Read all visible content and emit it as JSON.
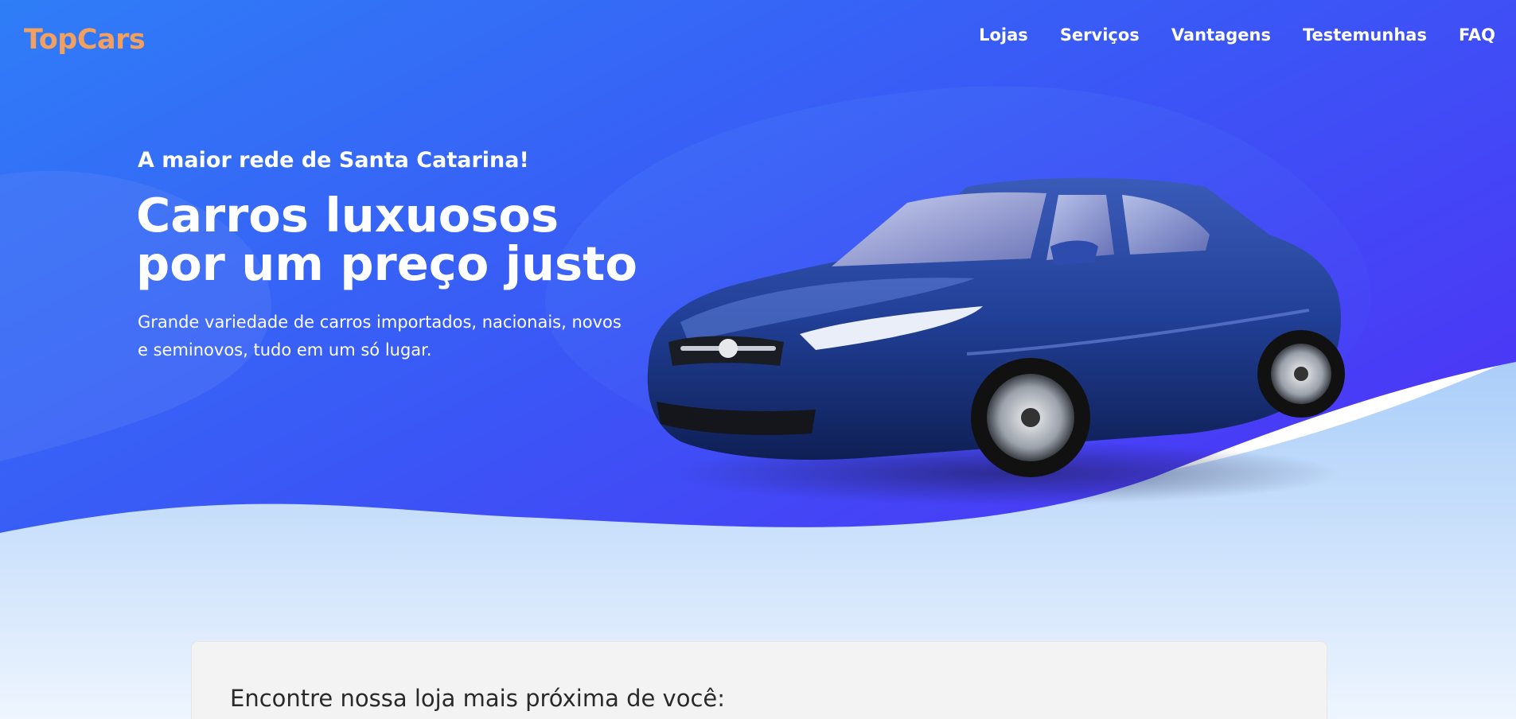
{
  "brand": {
    "logo": "TopCars"
  },
  "nav": {
    "items": [
      "Lojas",
      "Serviços",
      "Vantagens",
      "Testemunhas",
      "FAQ"
    ]
  },
  "hero": {
    "eyebrow": "A maior rede de Santa Catarina!",
    "title": "Carros luxuosos por um preço justo",
    "description": "Grande variedade de carros importados, nacionais, novos e seminovos, tudo em um só lugar.",
    "image_icon": "car-photo-icon"
  },
  "store_finder": {
    "title": "Encontre nossa loja mais próxima de você:"
  },
  "colors": {
    "gradient_start": "#2f7cf6",
    "gradient_end": "#4a3bf5",
    "logo": "#f2a060",
    "text": "#ffffff",
    "card_bg": "#f3f3f3"
  }
}
